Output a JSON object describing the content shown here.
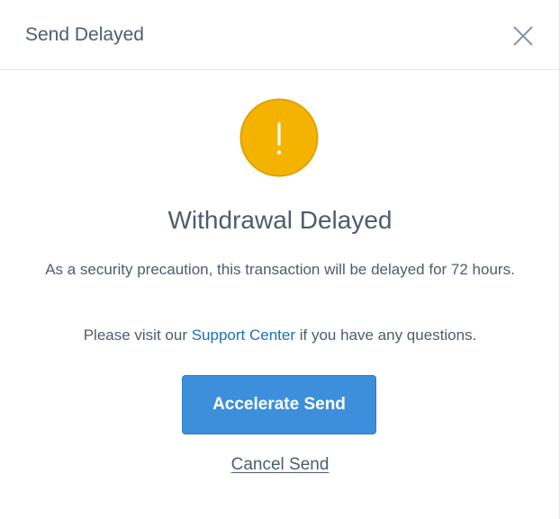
{
  "modal": {
    "title": "Send Delayed",
    "close_icon": "close-icon"
  },
  "alert": {
    "icon": "exclamation-icon",
    "icon_color": "#f5b301",
    "heading": "Withdrawal Delayed",
    "description": "As a security precaution, this transaction will be delayed for 72 hours.",
    "help_prefix": "Please visit our ",
    "help_link": "Support Center",
    "help_suffix": " if you have any questions."
  },
  "actions": {
    "accelerate_label": "Accelerate Send",
    "cancel_label": "Cancel Send"
  },
  "colors": {
    "primary_button": "#3d8fdc",
    "link": "#1d6fb8",
    "text": "#4e5c6e"
  }
}
